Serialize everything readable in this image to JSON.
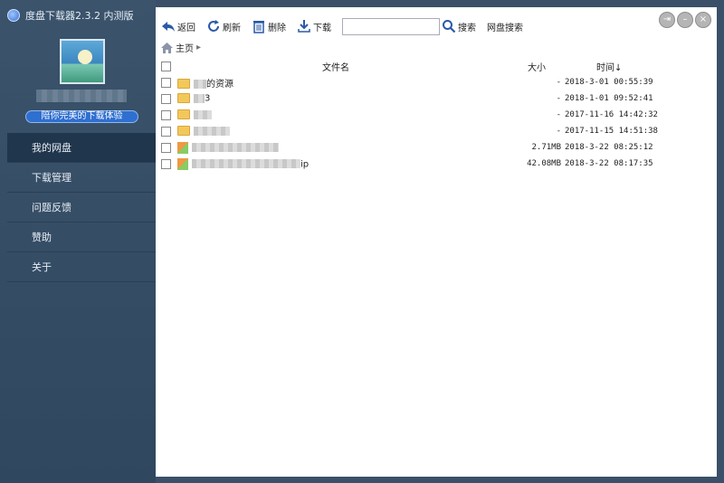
{
  "app": {
    "title": "度盘下载器2.3.2 内测版"
  },
  "profile": {
    "slogan": "陪你完美的下载体验"
  },
  "nav": [
    {
      "label": "我的网盘",
      "active": true
    },
    {
      "label": "下载管理"
    },
    {
      "label": "问题反馈"
    },
    {
      "label": "赞助"
    },
    {
      "label": "关于"
    }
  ],
  "toolbar": {
    "back": "返回",
    "refresh": "刷新",
    "delete": "删除",
    "download": "下载",
    "search_value": "",
    "search_btn": "搜索",
    "netdisk_search": "网盘搜索"
  },
  "breadcrumb": {
    "home": "主页"
  },
  "columns": {
    "name": "文件名",
    "size": "大小",
    "time": "时间↓"
  },
  "files": [
    {
      "type": "folder",
      "name": "的资源",
      "size": "-",
      "time": "2018-3-01 00:55:39"
    },
    {
      "type": "folder",
      "name": "3",
      "size": "-",
      "time": "2018-1-01 09:52:41"
    },
    {
      "type": "folder",
      "name": "",
      "size": "-",
      "time": "2017-11-16 14:42:32"
    },
    {
      "type": "folder",
      "name": "",
      "size": "-",
      "time": "2017-11-15 14:51:38"
    },
    {
      "type": "file",
      "name": "",
      "size": "2.71MB",
      "time": "2018-3-22 08:25:12"
    },
    {
      "type": "file",
      "name": "ip",
      "size": "42.08MB",
      "time": "2018-3-22 08:17:35"
    }
  ]
}
